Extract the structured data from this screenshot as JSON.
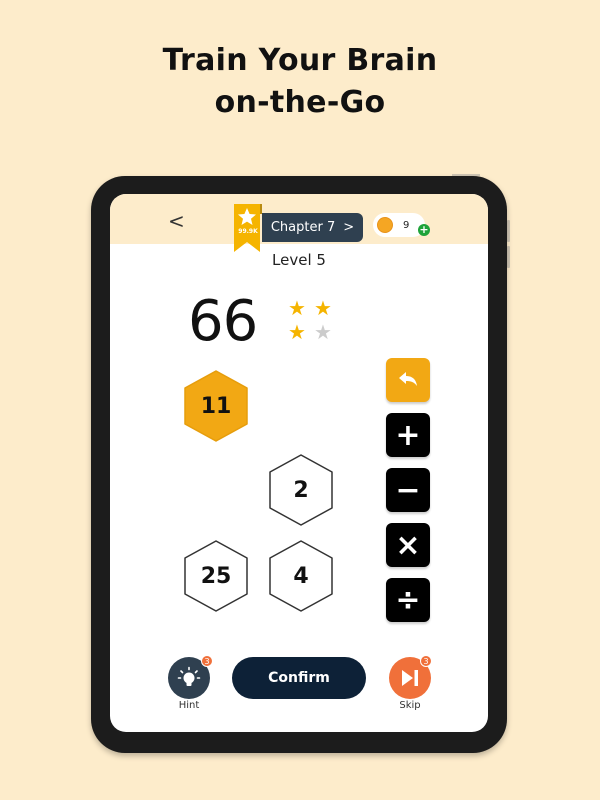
{
  "headline": {
    "line1": "Train Your Brain",
    "line2": "on-the-Go"
  },
  "header": {
    "back_label": "<",
    "ribbon_score": "99.9K",
    "chapter_label": "Chapter 7",
    "chapter_arrow": ">",
    "coin_count": "9",
    "coin_plus": "+"
  },
  "level_label": "Level 5",
  "target": "66",
  "stars": {
    "earned": 3,
    "total": 4,
    "filled_color": "#f5b400",
    "empty_color": "#cccccc"
  },
  "tiles": [
    {
      "value": "11",
      "state": "selected"
    },
    {
      "value": "2",
      "state": "available"
    },
    {
      "value": "25",
      "state": "available"
    },
    {
      "value": "4",
      "state": "available"
    }
  ],
  "operators": [
    {
      "name": "undo",
      "symbol": "↶"
    },
    {
      "name": "add",
      "symbol": "+"
    },
    {
      "name": "subtract",
      "symbol": "−"
    },
    {
      "name": "multiply",
      "symbol": "×"
    },
    {
      "name": "divide",
      "symbol": "÷"
    }
  ],
  "footer": {
    "hint_label": "Hint",
    "hint_count": "3",
    "confirm_label": "Confirm",
    "skip_label": "Skip",
    "skip_count": "3"
  },
  "colors": {
    "accent": "#f2a814",
    "dark": "#0d2137",
    "skip": "#f0703a",
    "background": "#fdeccb"
  }
}
